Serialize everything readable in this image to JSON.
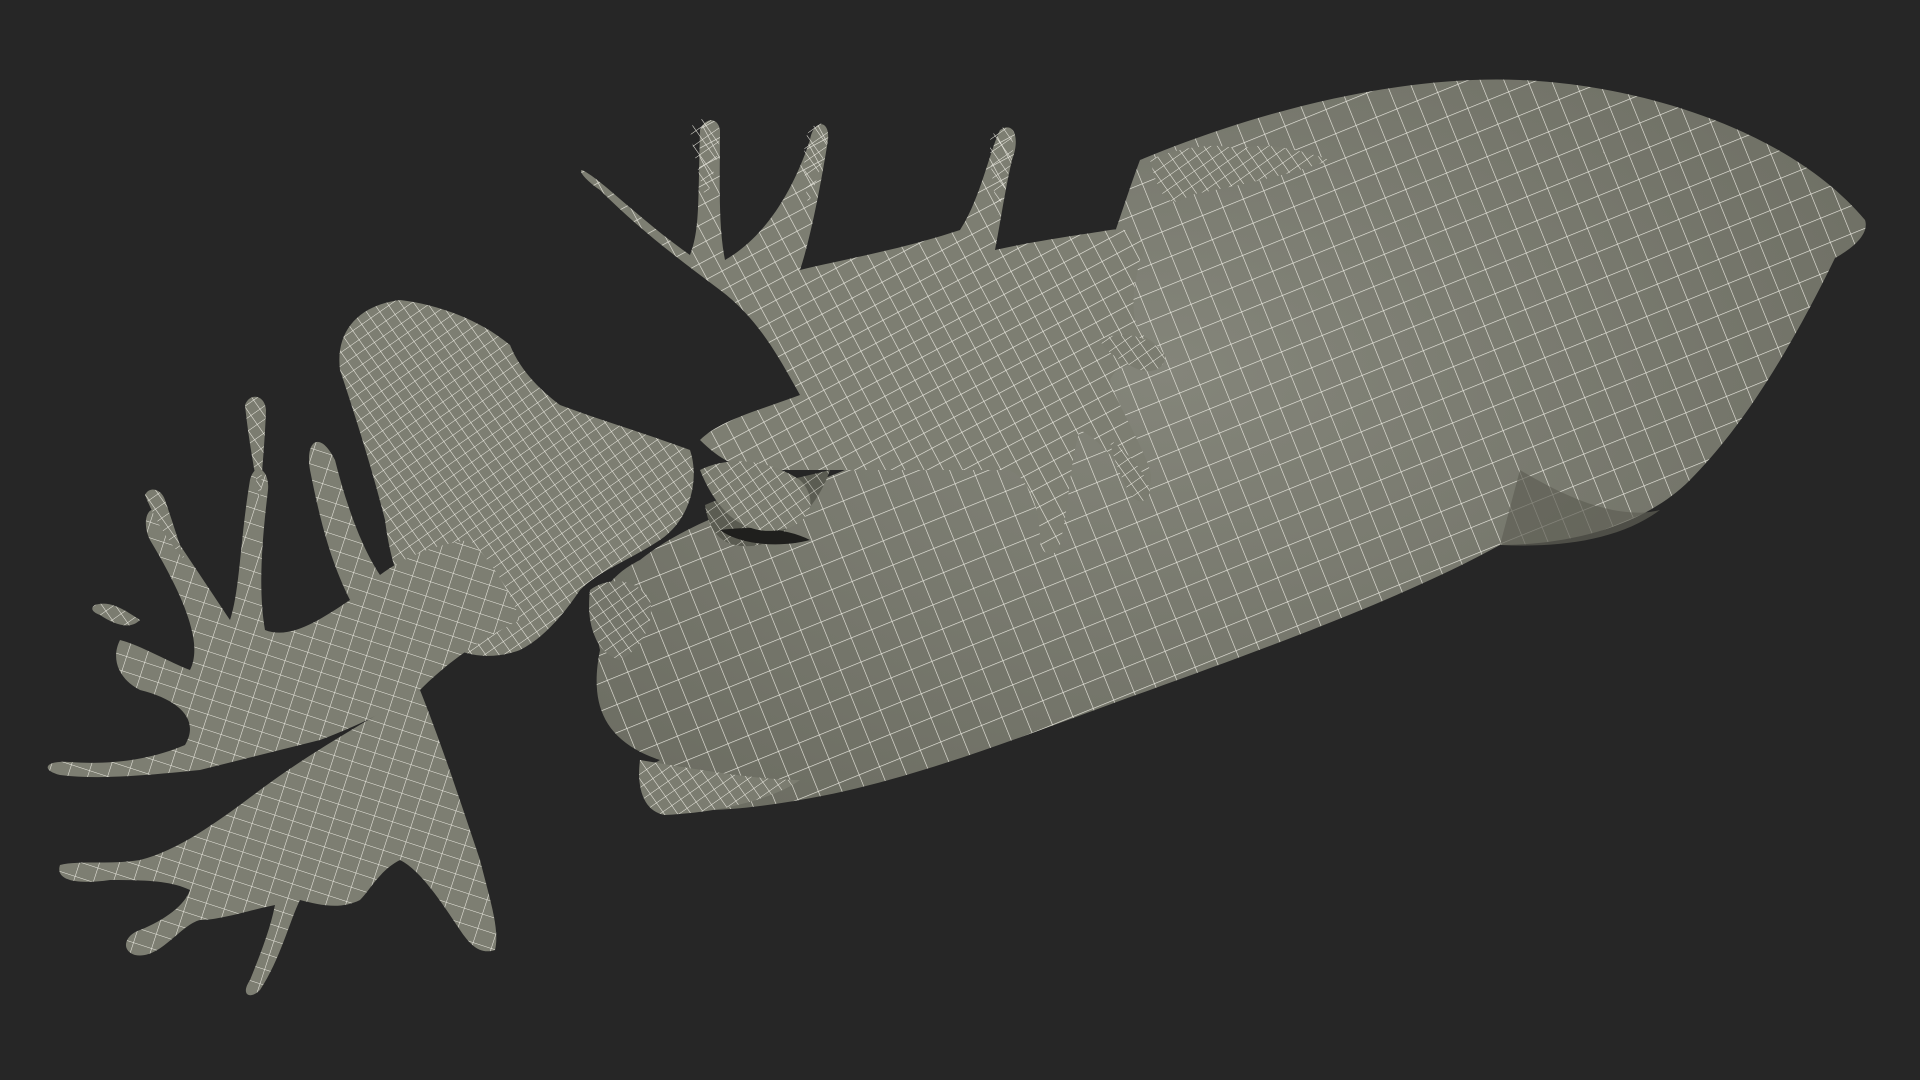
{
  "scene": {
    "subject": "moose-wireframe-render",
    "background_color": "#262626",
    "surface_color": "#7b7c70",
    "surface_shadow_color": "#5f6056",
    "wire_color": "#ecebe2"
  }
}
